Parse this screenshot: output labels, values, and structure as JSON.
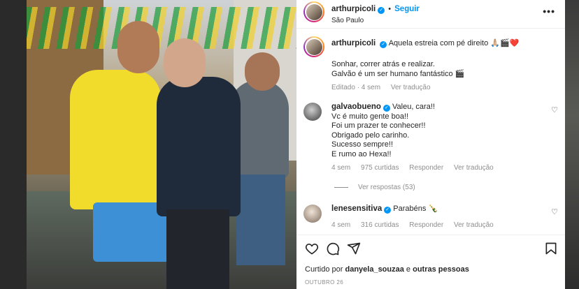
{
  "post": {
    "author": "arthurpicoli",
    "follow_label": "Seguir",
    "separator": "•",
    "location": "São Paulo",
    "more_label": "•••"
  },
  "caption": {
    "author": "arthurpicoli",
    "line1": "Aquela estreia com pé direito 🙏🏼🎬❤️",
    "line2": "Sonhar, correr atrás e realizar.",
    "line3": "Galvão é um ser humano fantástico 🎬",
    "edited": "Editado · 4 sem",
    "translate": "Ver tradução"
  },
  "comments": [
    {
      "author": "galvaobueno",
      "first": "Valeu, cara!!",
      "lines": [
        "Vc é muito gente boa!!",
        "Foi um prazer te conhecer!!",
        "Obrigado pelo carinho.",
        "Sucesso sempre!!",
        "E rumo ao Hexa!!"
      ],
      "time": "4 sem",
      "likes": "975 curtidas",
      "reply": "Responder",
      "translate": "Ver tradução"
    },
    {
      "author": "lenesensitiva",
      "first": "Parabéns 🍾",
      "lines": [],
      "time": "4 sem",
      "likes": "316 curtidas",
      "reply": "Responder",
      "translate": "Ver tradução"
    }
  ],
  "replies_label": "Ver respostas (53)",
  "liked_by": {
    "prefix": "Curtido por",
    "user": "danyela_souzaa",
    "middle": "e",
    "rest": "outras pessoas"
  },
  "date": "OUTUBRO 26",
  "icons": [
    "heart-icon",
    "comment-icon",
    "share-icon",
    "bookmark-icon",
    "more-icon",
    "verified-icon"
  ],
  "colors": {
    "accent": "#0095f6",
    "secondary_text": "#8e8e8e",
    "text": "#262626"
  }
}
